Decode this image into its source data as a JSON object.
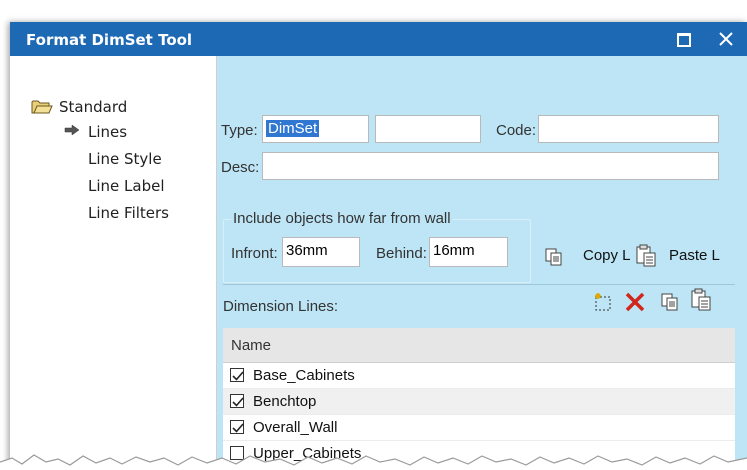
{
  "window": {
    "title": "Format DimSet Tool"
  },
  "tree": {
    "items": [
      {
        "label": "Standard",
        "icon": "folder-icon"
      },
      {
        "label": "Lines",
        "icon": "arrow-right-icon"
      },
      {
        "label": "Line Style"
      },
      {
        "label": "Line Label"
      },
      {
        "label": "Line Filters"
      }
    ]
  },
  "form": {
    "type_label": "Type:",
    "type_value": "DimSet",
    "type_extra_value": "",
    "code_label": "Code:",
    "code_value": "",
    "desc_label": "Desc:",
    "desc_value": "",
    "include_group_title": "Include objects how far from wall",
    "infront_label": "Infront:",
    "infront_value": "36mm",
    "behind_label": "Behind:",
    "behind_value": "16mm",
    "copy_label": "Copy L",
    "paste_label": "Paste L"
  },
  "dimension_lines": {
    "label": "Dimension Lines:",
    "column_header": "Name",
    "rows": [
      {
        "name": "Base_Cabinets",
        "checked": true
      },
      {
        "name": "Benchtop",
        "checked": true
      },
      {
        "name": "Overall_Wall",
        "checked": true
      },
      {
        "name": "Upper_Cabinets",
        "checked": false
      }
    ]
  },
  "colors": {
    "titlebar": "#1e69b4",
    "panel": "#bde5f5",
    "selection": "#2f77d1",
    "delete_red": "#d0261c"
  }
}
